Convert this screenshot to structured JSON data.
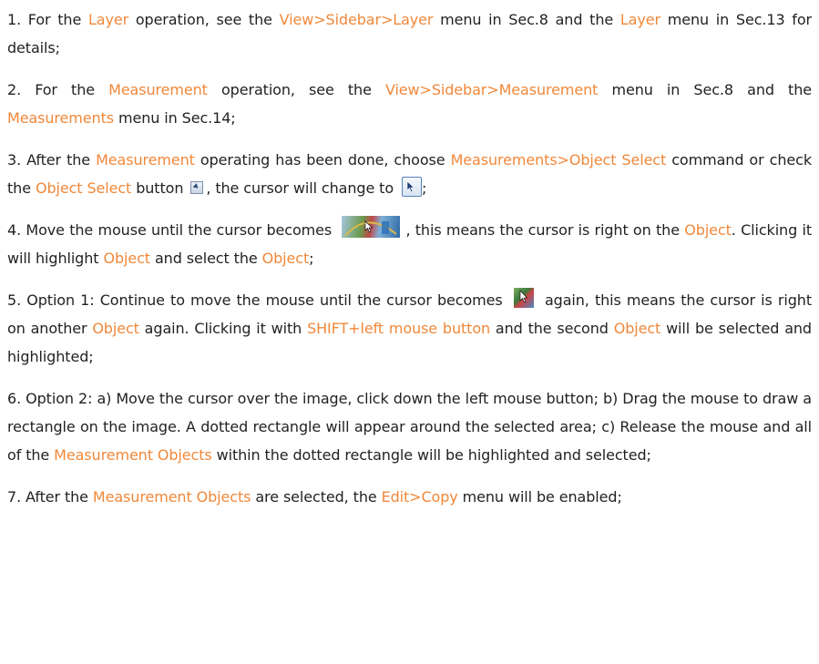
{
  "p1": {
    "a": "1. For the ",
    "b": "Layer",
    "c": " operation, see the ",
    "d": "View>Sidebar>Layer",
    "e": " menu in Sec.8 and the ",
    "f": "Layer",
    "g": " menu in Sec.13 for details;"
  },
  "p2": {
    "a": "2. For the ",
    "b": "Measurement",
    "c": " operation, see the ",
    "d": "View>Sidebar>Measurement",
    "e": " menu in Sec.8 and the ",
    "f": "Measurements",
    "g": " menu in Sec.14;"
  },
  "p3": {
    "a": "3. After the ",
    "b": "Measurement",
    "c": " operating has been done, choose ",
    "d": "Measurements>Object Select",
    "e": " command or check the ",
    "f": "Object Select",
    "g": " button ",
    "h": ", the cursor will change to ",
    "i": ";"
  },
  "p4": {
    "a": "4. Move the mouse until the cursor becomes ",
    "b": ", this means the cursor is right on the ",
    "c": "Object",
    "d": ". Clicking it will highlight ",
    "e": "Object",
    "f": " and select the ",
    "g": "Object",
    "h": ";"
  },
  "p5": {
    "a": "5. Option 1: Continue to move the mouse until the cursor becomes ",
    "b": " again, this means the cursor is right on another ",
    "c": "Object",
    "d": " again. Clicking it with ",
    "e": "SHIFT+left mouse button",
    "f": " and the second ",
    "g": "Object",
    "h": " will be selected and highlighted;"
  },
  "p6": {
    "a": "6. Option 2: a) Move the cursor over the image, click down the left mouse button; b) Drag the mouse to draw a rectangle on the image. A dotted rectangle will appear around the selected area; c) Release the mouse and all of the ",
    "b": "Measurement Objects",
    "c": " within the dotted rectangle will be highlighted and selected;"
  },
  "p7": {
    "a": "7. After the ",
    "b": "Measurement Objects",
    "c": " are selected, the ",
    "d": "Edit>Copy",
    "e": " menu will be enabled;"
  },
  "icons": {
    "object_select_button": "object-select-icon",
    "select_cursor": "arrow-cursor-icon",
    "object_cursor_wide": "object-hover-cursor-icon",
    "object_cursor_small": "object-hover-cursor-icon"
  },
  "colors": {
    "highlight": "#f0883a",
    "text": "#222222"
  }
}
